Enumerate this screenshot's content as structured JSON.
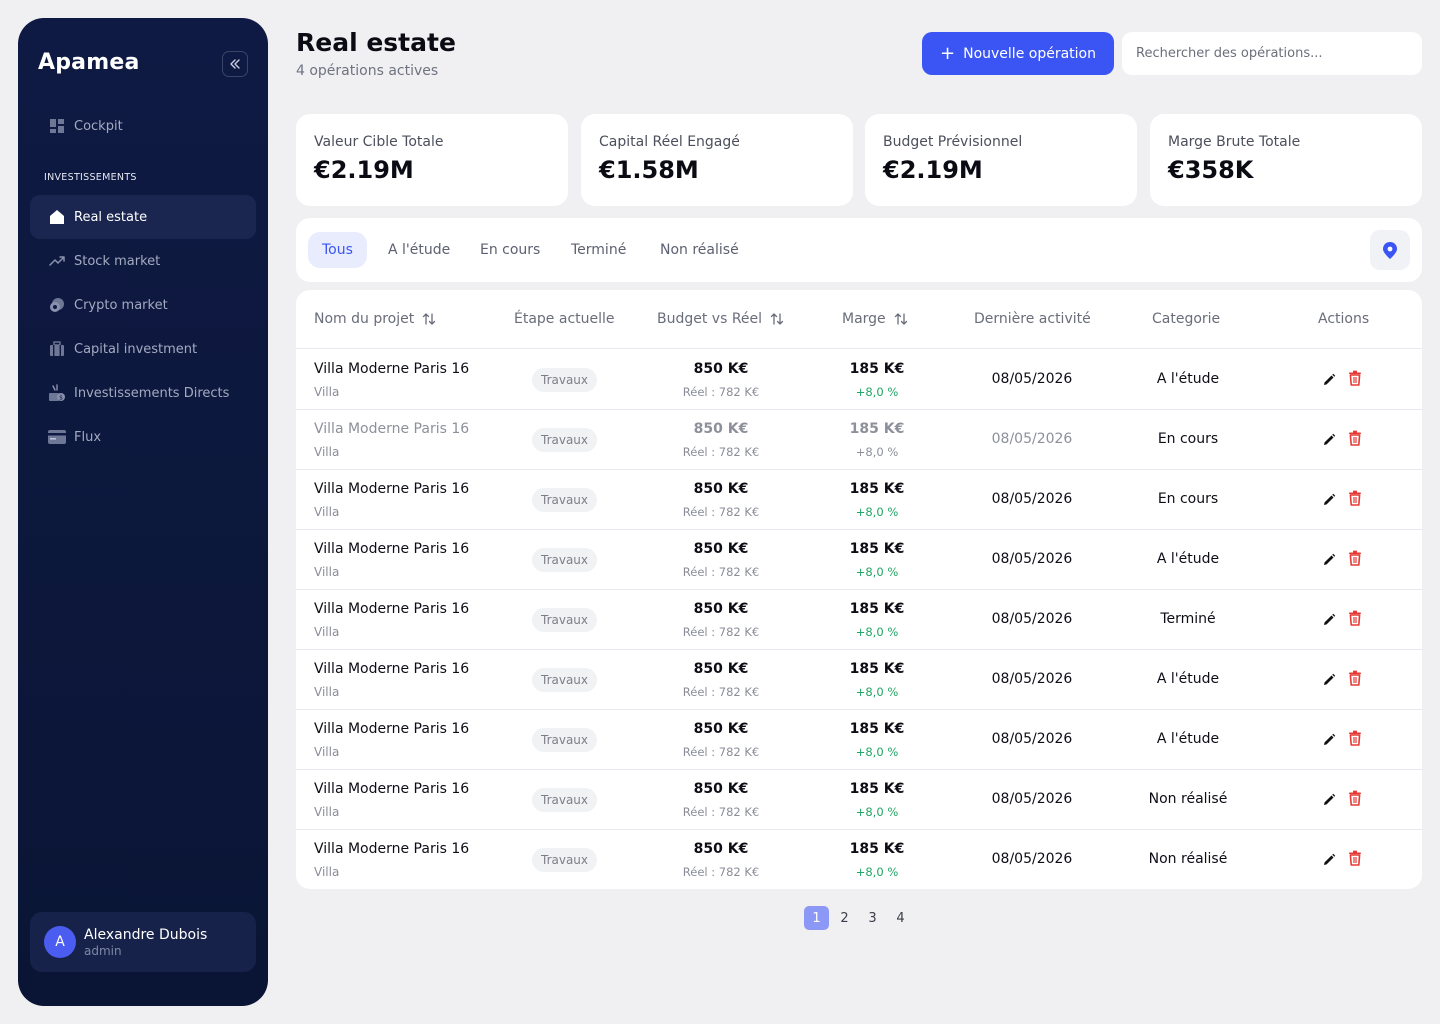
{
  "sidebar": {
    "brand": "Apamea",
    "section_label": "INVESTISSEMENTS",
    "items": [
      {
        "label": "Cockpit",
        "icon": "dashboard-icon",
        "active": false
      },
      {
        "label": "Real estate",
        "icon": "home-icon",
        "active": true
      },
      {
        "label": "Stock market",
        "icon": "trending-up-icon",
        "active": false
      },
      {
        "label": "Crypto market",
        "icon": "crypto-icon",
        "active": false
      },
      {
        "label": "Capital investment",
        "icon": "briefcase-icon",
        "active": false
      },
      {
        "label": "Investissements Directs",
        "icon": "investment-icon",
        "active": false
      },
      {
        "label": "Flux",
        "icon": "card-icon",
        "active": false
      }
    ],
    "user": {
      "initial": "A",
      "name": "Alexandre Dubois",
      "role": "admin"
    }
  },
  "header": {
    "title": "Real estate",
    "subtitle": "4 opérations actives",
    "new_button": "Nouvelle opération",
    "search_placeholder": "Rechercher des opérations..."
  },
  "stats": [
    {
      "label": "Valeur Cible Totale",
      "value": "€2.19M"
    },
    {
      "label": "Capital Réel Engagé",
      "value": "€1.58M"
    },
    {
      "label": "Budget Prévisionnel",
      "value": "€2.19M"
    },
    {
      "label": "Marge Brute Totale",
      "value": "€358K"
    }
  ],
  "filters": {
    "tabs": [
      "Tous",
      "A l'étude",
      "En cours",
      "Terminé",
      "Non réalisé"
    ],
    "active": "Tous"
  },
  "table": {
    "columns": [
      "Nom du projet",
      "Étape actuelle",
      "Budget vs Réel",
      "Marge",
      "Dernière activité",
      "Categorie",
      "Actions"
    ],
    "rows": [
      {
        "name": "Villa Moderne Paris 16",
        "type": "Villa",
        "stage": "Travaux",
        "budget": "850 K€",
        "reel": "Réel : 782 K€",
        "marge": "185 K€",
        "pct": "+8,0 %",
        "date": "08/05/2026",
        "category": "A l'étude",
        "muted": false
      },
      {
        "name": "Villa Moderne Paris 16",
        "type": "Villa",
        "stage": "Travaux",
        "budget": "850 K€",
        "reel": "Réel : 782 K€",
        "marge": "185 K€",
        "pct": "+8,0 %",
        "date": "08/05/2026",
        "category": "En cours",
        "muted": true
      },
      {
        "name": "Villa Moderne Paris 16",
        "type": "Villa",
        "stage": "Travaux",
        "budget": "850 K€",
        "reel": "Réel : 782 K€",
        "marge": "185 K€",
        "pct": "+8,0 %",
        "date": "08/05/2026",
        "category": "En cours",
        "muted": false
      },
      {
        "name": "Villa Moderne Paris 16",
        "type": "Villa",
        "stage": "Travaux",
        "budget": "850 K€",
        "reel": "Réel : 782 K€",
        "marge": "185 K€",
        "pct": "+8,0 %",
        "date": "08/05/2026",
        "category": "A l'étude",
        "muted": false
      },
      {
        "name": "Villa Moderne Paris 16",
        "type": "Villa",
        "stage": "Travaux",
        "budget": "850 K€",
        "reel": "Réel : 782 K€",
        "marge": "185 K€",
        "pct": "+8,0 %",
        "date": "08/05/2026",
        "category": "Terminé",
        "muted": false
      },
      {
        "name": "Villa Moderne Paris 16",
        "type": "Villa",
        "stage": "Travaux",
        "budget": "850 K€",
        "reel": "Réel : 782 K€",
        "marge": "185 K€",
        "pct": "+8,0 %",
        "date": "08/05/2026",
        "category": "A l'étude",
        "muted": false
      },
      {
        "name": "Villa Moderne Paris 16",
        "type": "Villa",
        "stage": "Travaux",
        "budget": "850 K€",
        "reel": "Réel : 782 K€",
        "marge": "185 K€",
        "pct": "+8,0 %",
        "date": "08/05/2026",
        "category": "A l'étude",
        "muted": false
      },
      {
        "name": "Villa Moderne Paris 16",
        "type": "Villa",
        "stage": "Travaux",
        "budget": "850 K€",
        "reel": "Réel : 782 K€",
        "marge": "185 K€",
        "pct": "+8,0 %",
        "date": "08/05/2026",
        "category": "Non réalisé",
        "muted": false
      },
      {
        "name": "Villa Moderne Paris 16",
        "type": "Villa",
        "stage": "Travaux",
        "budget": "850 K€",
        "reel": "Réel : 782 K€",
        "marge": "185 K€",
        "pct": "+8,0 %",
        "date": "08/05/2026",
        "category": "Non réalisé",
        "muted": false
      }
    ]
  },
  "pagination": {
    "pages": [
      "1",
      "2",
      "3",
      "4"
    ],
    "current": "1"
  },
  "colors": {
    "accent": "#3a55f3",
    "sidebar_bg": "#0f1a44",
    "positive": "#22a565",
    "danger": "#e53935"
  }
}
